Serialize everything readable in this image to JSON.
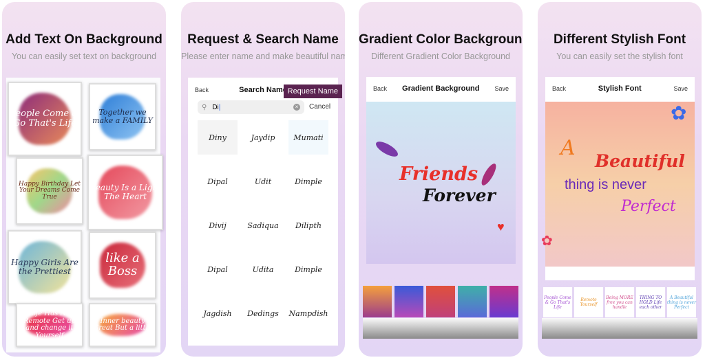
{
  "panels": [
    {
      "title": "Add Text On Background",
      "subtitle": "You can easily set text on background",
      "tiles": [
        {
          "text": "People Come & Go That's Life",
          "color": "#fff",
          "blob": "linear-gradient(135deg,#8e2d7a,#e88a5a)"
        },
        {
          "text": "Together we make a FAMILY",
          "color": "#1d2b4a",
          "blob": "linear-gradient(135deg,#2f7fd8,#8fc4f2)"
        },
        {
          "text": "Happy Birthday Let Your Dreams Come True",
          "color": "#6b2b1b",
          "blob": "linear-gradient(135deg,#f6c56b,#9fd88a,#f08aa0)"
        },
        {
          "text": "Beauty Is a Light The Heart",
          "color": "#fff",
          "blob": "linear-gradient(135deg,#e54a5c,#f29aa3)"
        },
        {
          "text": "Happy Girls Are the Prettiest",
          "color": "#2b3b5a",
          "blob": "linear-gradient(135deg,#6fb6d9,#f2e39a)"
        },
        {
          "text": "like a Boss",
          "color": "#fff",
          "blob": "linear-gradient(135deg,#c9283b,#e8707a)"
        },
        {
          "text": "Life Has No Remote Get up and change it Yourself",
          "color": "#fff",
          "blob": "linear-gradient(135deg,#e8384a,#e94ea4)"
        },
        {
          "text": "Inner beauty Great But a little",
          "color": "#fff",
          "blob": "linear-gradient(135deg,#f6a53e,#e64aa6)"
        }
      ]
    },
    {
      "title": "Request & Search Name",
      "subtitle": "Please enter name and make beautiful name",
      "back": "Back",
      "header": "Search Name",
      "request_button": "Request Name",
      "search_value": "Di",
      "cancel": "Cancel",
      "signatures": [
        "Diny",
        "Jaydip",
        "Mumati",
        "Dipal",
        "Udit",
        "Dimple",
        "Divij",
        "Sadiqua",
        "Dilipth",
        "Dipal",
        "Udita",
        "Dimple",
        "Jagdish",
        "Dedings",
        "Nampdish"
      ]
    },
    {
      "title": "Gradient Color Background",
      "subtitle": "Different Gradient Color Background",
      "back": "Back",
      "header": "Gradient Background",
      "save": "Save",
      "line1": "Friends",
      "line2": "Forever",
      "swatches": [
        [
          "#f4a03c",
          "#9b3c8c"
        ],
        [
          "#3a5ad8",
          "#b84ab8"
        ],
        [
          "#e0503c",
          "#c0407a"
        ],
        [
          "#3fb0a8",
          "#5a6ad8"
        ],
        [
          "#c0308a",
          "#6a3ad0"
        ]
      ]
    },
    {
      "title": "Different Stylish Font",
      "subtitle": "You can easily set the stylish font",
      "back": "Back",
      "header": "Stylish Font",
      "save": "Save",
      "lines": [
        "A",
        "Beautiful",
        "thing is never",
        "Perfect"
      ],
      "thumbs": [
        {
          "text": "People Come & Go That's Life",
          "color": "#a04ad0"
        },
        {
          "text": "Remote Yourself",
          "color": "#e8952a"
        },
        {
          "text": "Being MORE free you can handle",
          "color": "#d04a8a"
        },
        {
          "text": "THING TO HOLD Life each other",
          "color": "#5a3ab0"
        },
        {
          "text": "A Beautiful thing is never Perfect",
          "color": "#4aa0d8"
        }
      ]
    }
  ],
  "colors": {
    "tooltip_bg": "#5a2350",
    "friends": "#e8302a"
  }
}
